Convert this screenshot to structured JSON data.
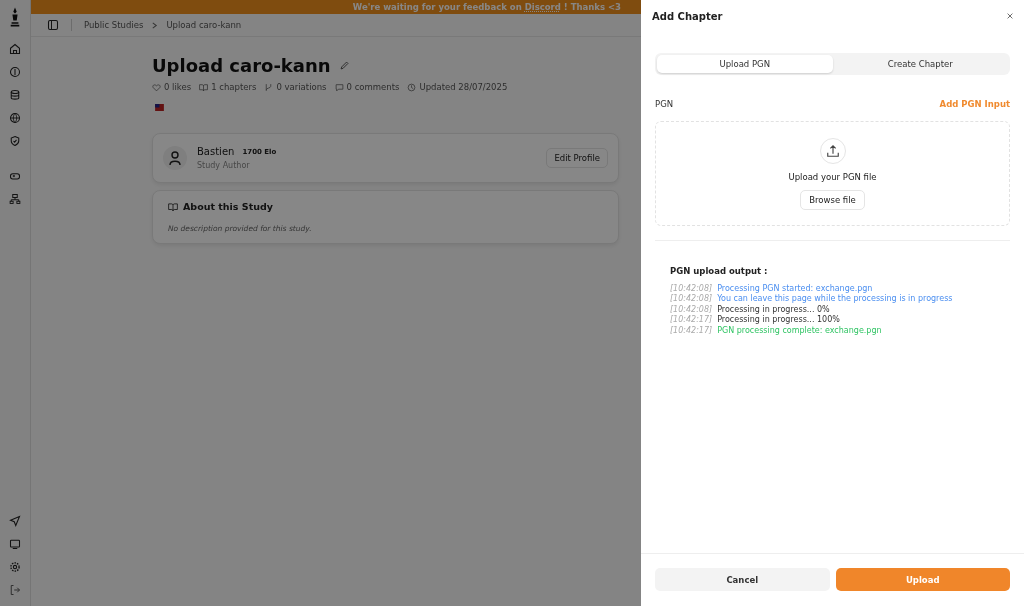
{
  "banner": {
    "before": "We're waiting for your feedback on",
    "link": "Discord",
    "after": "! Thanks <3"
  },
  "breadcrumb": [
    "Public Studies",
    "Upload caro-kann"
  ],
  "study": {
    "title": "Upload caro-kann",
    "stats": [
      {
        "kind": "likes",
        "text": "0 likes"
      },
      {
        "kind": "chapters",
        "text": "1 chapters"
      },
      {
        "kind": "variations",
        "text": "0 variations"
      },
      {
        "kind": "comments",
        "text": "0 comments"
      },
      {
        "kind": "updated",
        "text": "Updated 28/07/2025"
      }
    ]
  },
  "author": {
    "name": "Bastien",
    "elo": "1700 Elo",
    "role": "Study Author",
    "button": "Edit Profile"
  },
  "about": {
    "title": "About this Study",
    "text": "No description provided for this study."
  },
  "dialog": {
    "title": "Add Chapter",
    "tabs": [
      {
        "label": "Upload PGN",
        "selected": true
      },
      {
        "label": "Create Chapter",
        "selected": false
      }
    ],
    "pgn_label": "PGN",
    "add_input": "Add PGN Input",
    "upload_text": "Upload your PGN file",
    "browse": "Browse file",
    "output_title": "PGN upload output :",
    "log": [
      {
        "time": "[10:42:08]",
        "text": "Processing PGN started: exchange.pgn",
        "kind": "info"
      },
      {
        "time": "[10:42:08]",
        "text": "You can leave this page while the processing is in progress",
        "kind": "info"
      },
      {
        "time": "[10:42:08]",
        "text": "Processing in progress... 0%",
        "kind": "normal"
      },
      {
        "time": "[10:42:17]",
        "text": "Processing in progress... 100%",
        "kind": "normal"
      },
      {
        "time": "[10:42:17]",
        "text": "PGN processing complete: exchange.pgn",
        "kind": "success"
      }
    ],
    "cancel": "Cancel",
    "upload": "Upload"
  }
}
